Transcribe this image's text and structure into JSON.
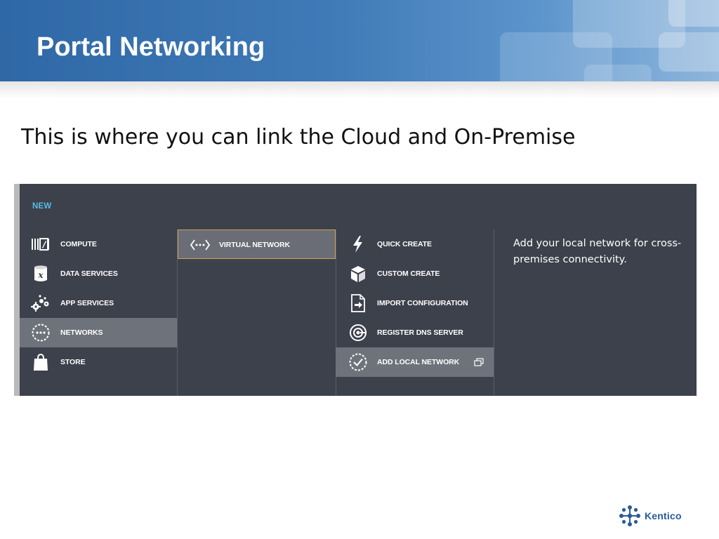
{
  "slide": {
    "title": "Portal Networking",
    "subtitle": "This is where you can link the Cloud and On-Premise"
  },
  "portal": {
    "new_label": "NEW",
    "categories": [
      {
        "label": "COMPUTE",
        "icon": "compute-icon"
      },
      {
        "label": "DATA SERVICES",
        "icon": "database-icon"
      },
      {
        "label": "APP SERVICES",
        "icon": "gears-icon"
      },
      {
        "label": "NETWORKS",
        "icon": "network-icon",
        "selected": true
      },
      {
        "label": "STORE",
        "icon": "shopping-bag-icon"
      }
    ],
    "services": [
      {
        "label": "VIRTUAL NETWORK",
        "icon": "virtual-network-icon",
        "selected": true
      }
    ],
    "actions": [
      {
        "label": "QUICK CREATE",
        "icon": "lightning-icon"
      },
      {
        "label": "CUSTOM CREATE",
        "icon": "cube-icon"
      },
      {
        "label": "IMPORT CONFIGURATION",
        "icon": "import-file-icon"
      },
      {
        "label": "REGISTER DNS SERVER",
        "icon": "dns-server-icon"
      },
      {
        "label": "ADD LOCAL NETWORK",
        "icon": "checkmark-circle-icon",
        "selected": true
      }
    ],
    "description": "Add your local network for cross-premises connectivity."
  },
  "branding": {
    "logo_text": "Kentico"
  },
  "colors": {
    "banner": "#3f79b6",
    "portal_bg": "#3d414c",
    "selected_bg": "#6e727b",
    "new_label": "#54bde4",
    "logo": "#2a5a9e"
  }
}
